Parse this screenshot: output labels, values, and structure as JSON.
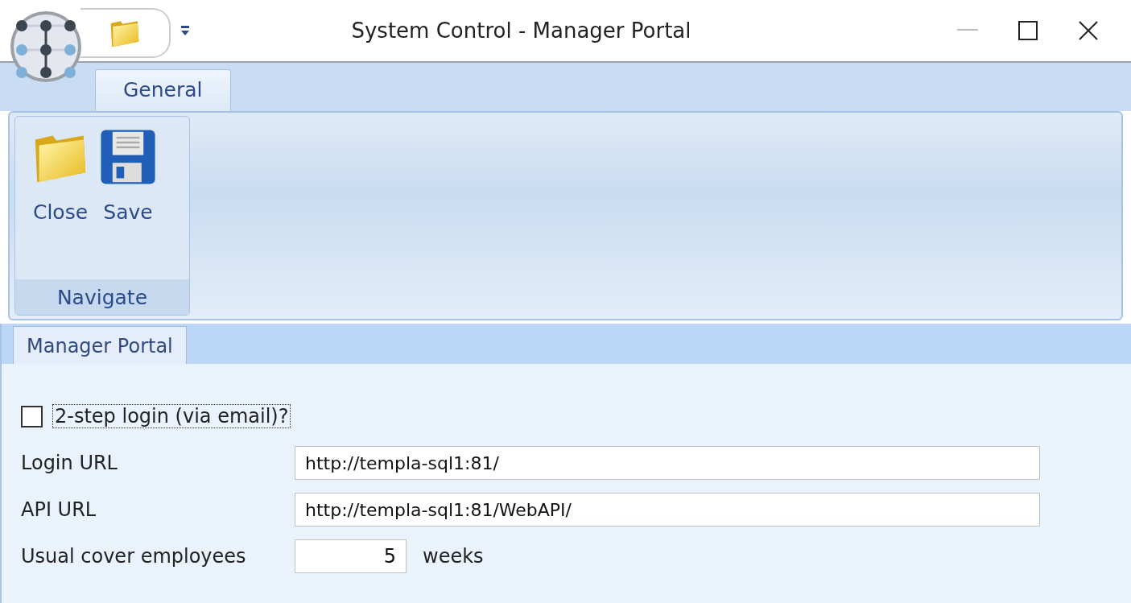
{
  "window": {
    "title": "System Control - Manager Portal"
  },
  "ribbon": {
    "tabs": [
      {
        "label": "General",
        "selected": true
      }
    ],
    "groups": [
      {
        "label": "Navigate",
        "buttons": [
          {
            "label": "Close",
            "kind": "folder"
          },
          {
            "label": "Save",
            "kind": "disk"
          }
        ]
      }
    ]
  },
  "document_tabs": [
    {
      "label": "Manager Portal",
      "selected": true
    }
  ],
  "form": {
    "checkbox": {
      "label": "2-step login (via email)?",
      "checked": false
    },
    "fields": [
      {
        "label": "Login URL",
        "value": "http://templa-sql1:81/",
        "kind": "text"
      },
      {
        "label": "API URL",
        "value": "http://templa-sql1:81/WebAPI/",
        "kind": "text"
      },
      {
        "label": "Usual cover employees",
        "value": "5",
        "kind": "number",
        "unit": "weeks"
      }
    ]
  }
}
